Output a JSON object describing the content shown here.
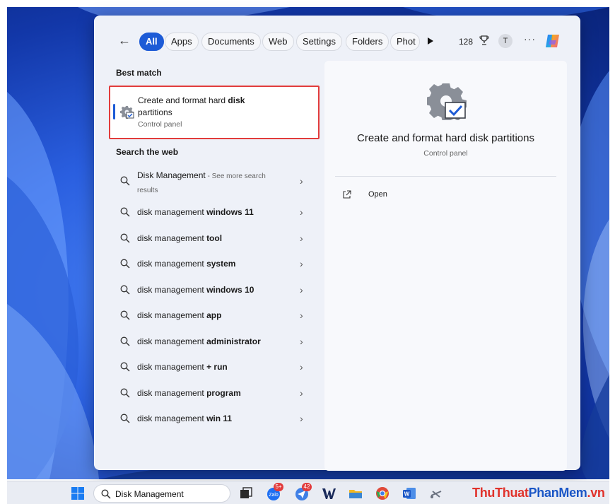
{
  "filters": {
    "all": "All",
    "apps": "Apps",
    "documents": "Documents",
    "web": "Web",
    "settings": "Settings",
    "folders": "Folders",
    "photos": "Phot"
  },
  "header": {
    "points": "128",
    "avatar_initial": "T",
    "more": "···"
  },
  "best_match": {
    "section_title": "Best match",
    "title_normal": "Create and format hard ",
    "title_bold": "disk",
    "title_line2": "partitions",
    "subtitle": "Control panel"
  },
  "search_web": {
    "section_title": "Search the web",
    "first": {
      "text": "Disk Management",
      "suffix": " - See more search",
      "suffix2": "results"
    },
    "items": [
      {
        "prefix": "disk management ",
        "bold": "windows 11"
      },
      {
        "prefix": "disk management ",
        "bold": "tool"
      },
      {
        "prefix": "disk management ",
        "bold": "system"
      },
      {
        "prefix": "disk management ",
        "bold": "windows 10"
      },
      {
        "prefix": "disk management ",
        "bold": "app"
      },
      {
        "prefix": "disk management ",
        "bold": "administrator"
      },
      {
        "prefix": "disk management ",
        "bold": "+ run"
      },
      {
        "prefix": "disk management ",
        "bold": "program"
      },
      {
        "prefix": "disk management ",
        "bold": "win 11"
      }
    ]
  },
  "preview": {
    "title": "Create and format hard disk partitions",
    "subtitle": "Control panel",
    "open_label": "Open"
  },
  "taskbar": {
    "search_value": "Disk Management",
    "zalo_badge": "5+",
    "app_badge": "42",
    "watermark_a": "ThuThuat",
    "watermark_b": "PhanMem",
    "watermark_c": ".vn"
  },
  "colors": {
    "accent": "#1d5bd6",
    "highlight_border": "#e23c3c"
  }
}
